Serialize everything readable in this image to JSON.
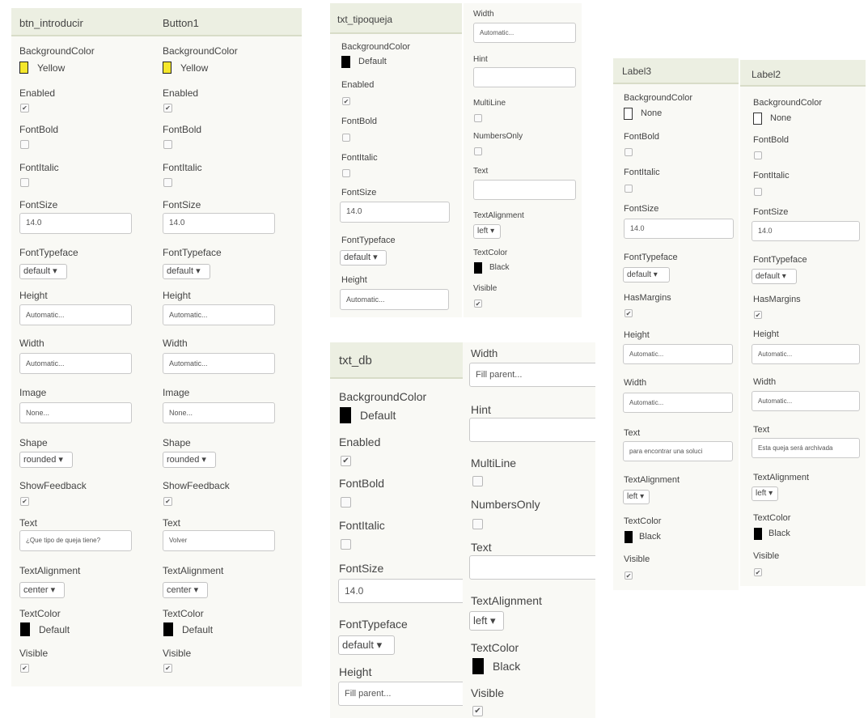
{
  "colors": {
    "yellow": "#f5e72c",
    "black": "#000000",
    "none": "#ffffff"
  },
  "btn_introducir": {
    "title": "btn_introducir",
    "background_color_label": "BackgroundColor",
    "background_color_value": "Yellow",
    "enabled_label": "Enabled",
    "enabled_mark": "✔",
    "font_bold_label": "FontBold",
    "font_italic_label": "FontItalic",
    "font_size_label": "FontSize",
    "font_size_value": "14.0",
    "font_typeface_label": "FontTypeface",
    "font_typeface_value": "default ▾",
    "height_label": "Height",
    "height_value": "Automatic...",
    "width_label": "Width",
    "width_value": "Automatic...",
    "image_label": "Image",
    "image_value": "None...",
    "shape_label": "Shape",
    "shape_value": "rounded ▾",
    "show_feedback_label": "ShowFeedback",
    "show_feedback_mark": "✔",
    "text_label": "Text",
    "text_value": "¿Que tipo de queja tiene?",
    "text_alignment_label": "TextAlignment",
    "text_alignment_value": "center ▾",
    "text_color_label": "TextColor",
    "text_color_value": "Default",
    "visible_label": "Visible",
    "visible_mark": "✔"
  },
  "button1": {
    "title": "Button1",
    "background_color_label": "BackgroundColor",
    "background_color_value": "Yellow",
    "enabled_label": "Enabled",
    "enabled_mark": "✔",
    "font_bold_label": "FontBold",
    "font_italic_label": "FontItalic",
    "font_size_label": "FontSize",
    "font_size_value": "14.0",
    "font_typeface_label": "FontTypeface",
    "font_typeface_value": "default ▾",
    "height_label": "Height",
    "height_value": "Automatic...",
    "width_label": "Width",
    "width_value": "Automatic...",
    "image_label": "Image",
    "image_value": "None...",
    "shape_label": "Shape",
    "shape_value": "rounded ▾",
    "show_feedback_label": "ShowFeedback",
    "show_feedback_mark": "✔",
    "text_label": "Text",
    "text_value": "Volver",
    "text_alignment_label": "TextAlignment",
    "text_alignment_value": "center ▾",
    "text_color_label": "TextColor",
    "text_color_value": "Default",
    "visible_label": "Visible",
    "visible_mark": "✔"
  },
  "txt_tipoqueja": {
    "title": "txt_tipoqueja",
    "background_color_label": "BackgroundColor",
    "background_color_value": "Default",
    "enabled_label": "Enabled",
    "enabled_mark": "✔",
    "font_bold_label": "FontBold",
    "font_italic_label": "FontItalic",
    "font_size_label": "FontSize",
    "font_size_value": "14.0",
    "font_typeface_label": "FontTypeface",
    "font_typeface_value": "default ▾",
    "height_label": "Height",
    "height_value": "Automatic...",
    "width_label": "Width",
    "width_value": "Automatic...",
    "hint_label": "Hint",
    "hint_value": "",
    "multiline_label": "MultiLine",
    "numbers_only_label": "NumbersOnly",
    "text_label": "Text",
    "text_value": "",
    "text_alignment_label": "TextAlignment",
    "text_alignment_value": "left ▾",
    "text_color_label": "TextColor",
    "text_color_value": "Black",
    "visible_label": "Visible",
    "visible_mark": "✔"
  },
  "txt_db": {
    "title": "txt_db",
    "background_color_label": "BackgroundColor",
    "background_color_value": "Default",
    "enabled_label": "Enabled",
    "enabled_mark": "✔",
    "font_bold_label": "FontBold",
    "font_italic_label": "FontItalic",
    "font_size_label": "FontSize",
    "font_size_value": "14.0",
    "font_typeface_label": "FontTypeface",
    "font_typeface_value": "default ▾",
    "height_label": "Height",
    "height_value": "Fill parent...",
    "width_label": "Width",
    "width_value": "Fill parent...",
    "hint_label": "Hint",
    "hint_value": "",
    "multiline_label": "MultiLine",
    "numbers_only_label": "NumbersOnly",
    "text_label": "Text",
    "text_value": "",
    "text_alignment_label": "TextAlignment",
    "text_alignment_value": "left ▾",
    "text_color_label": "TextColor",
    "text_color_value": "Black",
    "visible_label": "Visible",
    "visible_mark": "✔"
  },
  "label3": {
    "title": "Label3",
    "background_color_label": "BackgroundColor",
    "background_color_value": "None",
    "font_bold_label": "FontBold",
    "font_italic_label": "FontItalic",
    "font_size_label": "FontSize",
    "font_size_value": "14.0",
    "font_typeface_label": "FontTypeface",
    "font_typeface_value": "default ▾",
    "has_margins_label": "HasMargins",
    "has_margins_mark": "✔",
    "height_label": "Height",
    "height_value": "Automatic...",
    "width_label": "Width",
    "width_value": "Automatic...",
    "text_label": "Text",
    "text_value": "para encontrar una soluci",
    "text_alignment_label": "TextAlignment",
    "text_alignment_value": "left ▾",
    "text_color_label": "TextColor",
    "text_color_value": "Black",
    "visible_label": "Visible",
    "visible_mark": "✔"
  },
  "label2": {
    "title": "Label2",
    "background_color_label": "BackgroundColor",
    "background_color_value": "None",
    "font_bold_label": "FontBold",
    "font_italic_label": "FontItalic",
    "font_size_label": "FontSize",
    "font_size_value": "14.0",
    "font_typeface_label": "FontTypeface",
    "font_typeface_value": "default ▾",
    "has_margins_label": "HasMargins",
    "has_margins_mark": "✔",
    "height_label": "Height",
    "height_value": "Automatic...",
    "width_label": "Width",
    "width_value": "Automatic...",
    "text_label": "Text",
    "text_value": "Esta queja será archivada",
    "text_alignment_label": "TextAlignment",
    "text_alignment_value": "left ▾",
    "text_color_label": "TextColor",
    "text_color_value": "Black",
    "visible_label": "Visible",
    "visible_mark": "✔"
  }
}
